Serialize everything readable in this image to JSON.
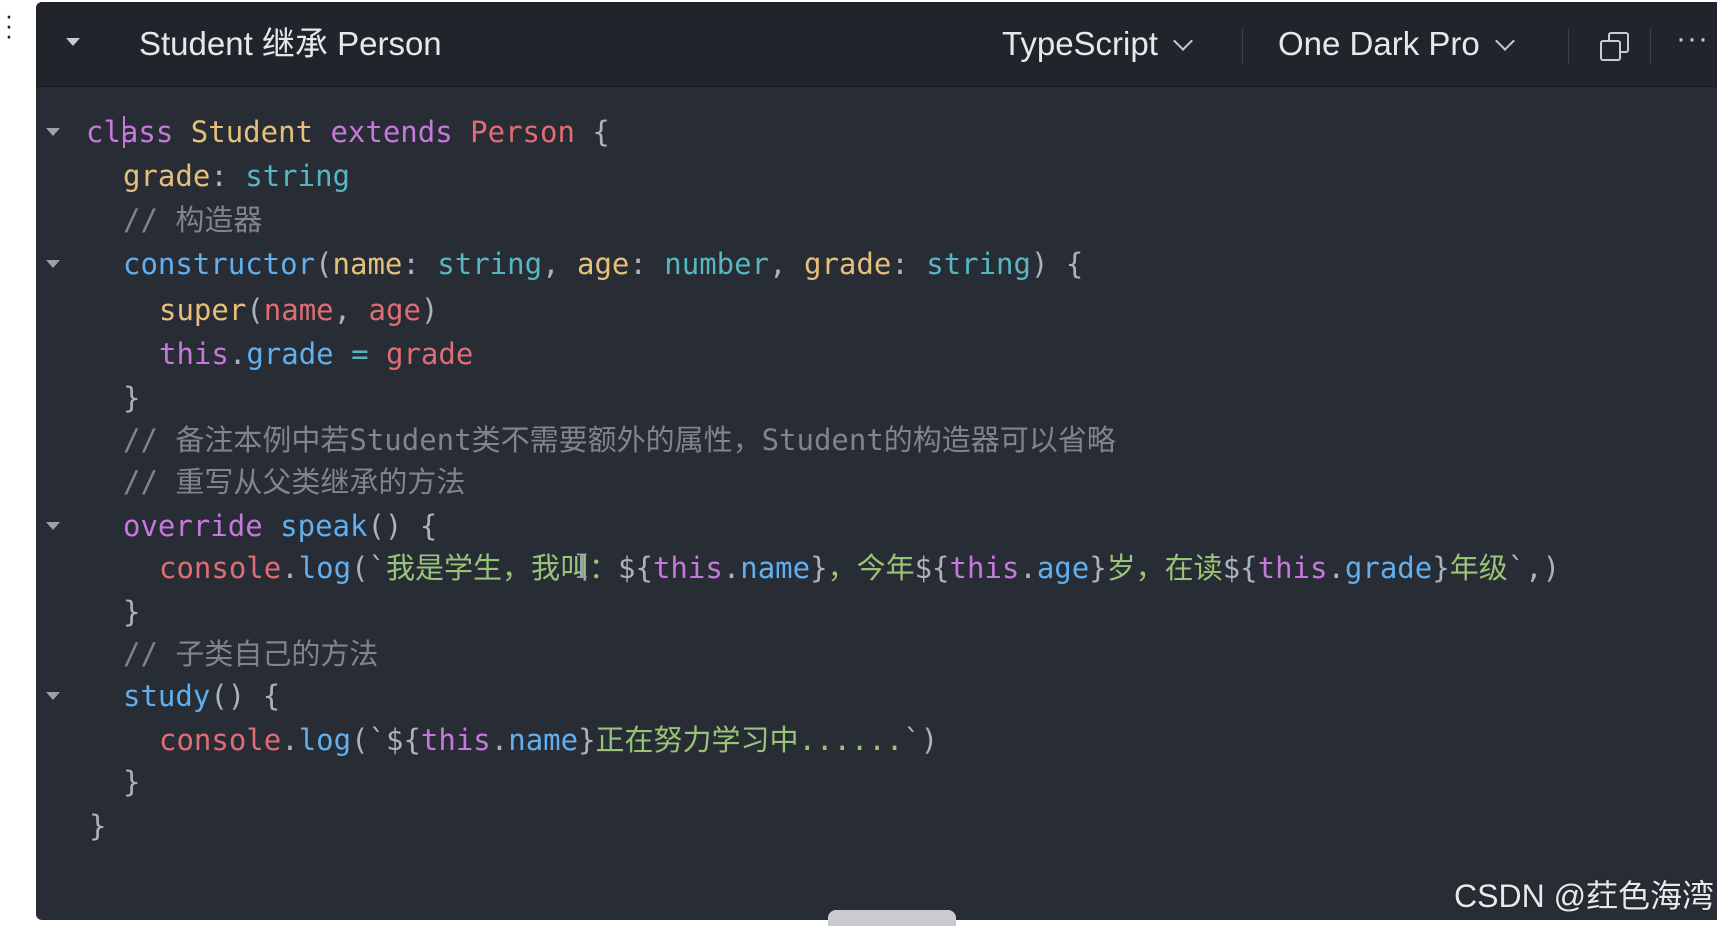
{
  "colors": {
    "editor_bg": "#282c34",
    "toolbar_bg": "#21252b",
    "keyword": "#c678dd",
    "class_name": "#e5c07b",
    "function": "#61afef",
    "property": "#e06c75",
    "type": "#56b6c2",
    "string": "#98c379",
    "comment": "#7f848e"
  },
  "toolbar": {
    "title": "Student 继承 Person",
    "language": "TypeScript",
    "theme": "One Dark Pro",
    "more": "···",
    "icons": [
      "collapse-triangle-icon",
      "chevron-down-icon",
      "copy-icon",
      "more-icon"
    ]
  },
  "code": {
    "l1": {
      "a": "class",
      "b": " ",
      "c": "Student",
      "d": " ",
      "e": "extends",
      "f": " ",
      "g": "Person",
      "h": " {"
    },
    "l2": {
      "a": "grade",
      "b": ": ",
      "c": "string"
    },
    "l3": {
      "a": "// 构造器"
    },
    "l4": {
      "a": "constructor",
      "b": "(",
      "c": "name",
      "d": ": ",
      "e": "string",
      "f": ", ",
      "g": "age",
      "h": ": ",
      "i": "number",
      "j": ", ",
      "k": "grade",
      "l": ": ",
      "m": "string",
      "n": ") {"
    },
    "l5": {
      "a": "super",
      "b": "(",
      "c": "name",
      "d": ", ",
      "e": "age",
      "f": ")"
    },
    "l6": {
      "a": "this",
      "b": ".",
      "c": "grade",
      "d": " = ",
      "e": "grade"
    },
    "l7": {
      "a": "}"
    },
    "l8": {
      "a": "// 备注本例中若Student类不需要额外的属性，Student的构造器可以省略"
    },
    "l9": {
      "a": "// 重写从父类继承的方法"
    },
    "l10": {
      "a": "override",
      "b": " ",
      "c": "speak",
      "d": "() {"
    },
    "l11": {
      "a": "console",
      "b": ".",
      "c": "log",
      "d": "(`",
      "e": "我是学生，我叫：",
      "f": "${",
      "g": "this",
      "h": ".",
      "i": "name",
      "j": "}",
      "k": "，今年",
      "l": "${",
      "m": "this",
      "n": ".",
      "o": "age",
      "p": "}",
      "q": "岁，在读",
      "r": "${",
      "s": "this",
      "t": ".",
      "u": "grade",
      "v": "}",
      "w": "年级",
      "x": "`,)"
    },
    "l12": {
      "a": "}"
    },
    "l13": {
      "a": "// 子类自己的方法"
    },
    "l14": {
      "a": "study",
      "b": "() {"
    },
    "l15": {
      "a": "console",
      "b": ".",
      "c": "log",
      "d": "(`",
      "e": "${",
      "f": "this",
      "g": ".",
      "h": "name",
      "i": "}",
      "j": "正在努力学习中......",
      "k": "`)"
    },
    "l16": {
      "a": "}"
    },
    "l17": {
      "a": "}"
    }
  },
  "watermark": "CSDN @荭色海湾"
}
